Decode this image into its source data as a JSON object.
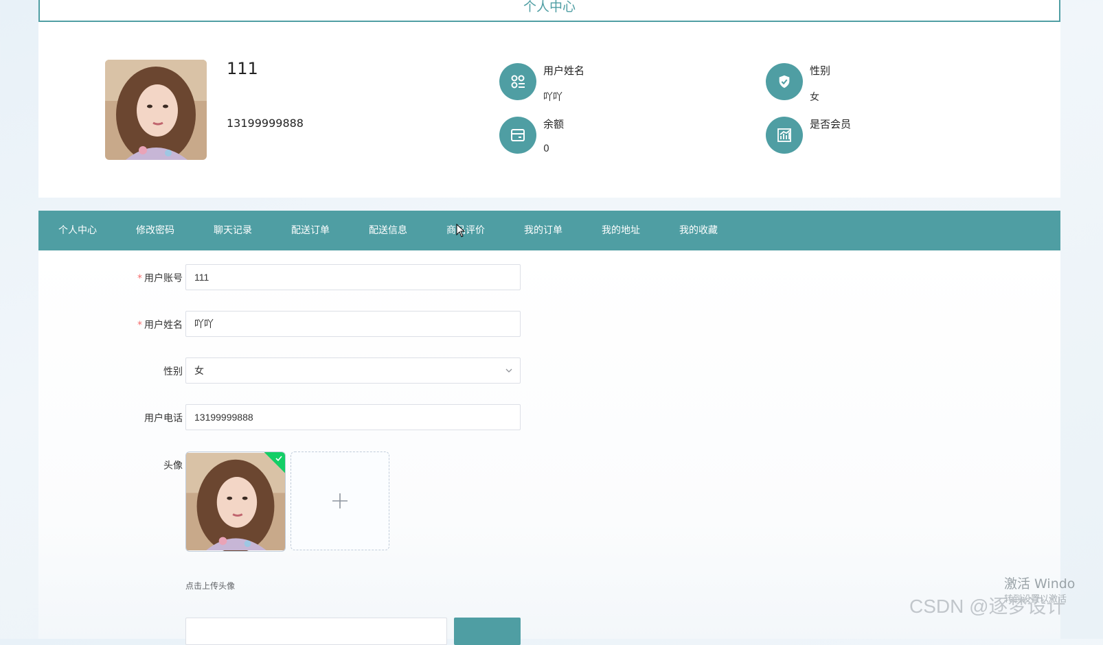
{
  "page": {
    "title": "个人中心"
  },
  "profile": {
    "account": "111",
    "phone": "13199999888",
    "fields": [
      {
        "icon": "grid-icon",
        "label": "用户姓名",
        "value": "吖吖"
      },
      {
        "icon": "shield-check-icon",
        "label": "性别",
        "value": "女"
      },
      {
        "icon": "wallet-icon",
        "label": "余额",
        "value": "0"
      },
      {
        "icon": "chart-icon",
        "label": "是否会员",
        "value": ""
      }
    ]
  },
  "tabs": [
    {
      "label": "个人中心"
    },
    {
      "label": "修改密码"
    },
    {
      "label": "聊天记录"
    },
    {
      "label": "配送订单"
    },
    {
      "label": "配送信息"
    },
    {
      "label": "商品评价"
    },
    {
      "label": "我的订单"
    },
    {
      "label": "我的地址"
    },
    {
      "label": "我的收藏"
    }
  ],
  "form": {
    "account_label": "用户账号",
    "account_value": "111",
    "name_label": "用户姓名",
    "name_value": "吖吖",
    "gender_label": "性别",
    "gender_value": "女",
    "phone_label": "用户电话",
    "phone_value": "13199999888",
    "avatar_label": "头像",
    "upload_tip": "点击上传头像"
  },
  "watermarks": {
    "windows_line1": "激活 Windo",
    "windows_line2": "转到设置以激活",
    "csdn": "CSDN @逐梦设计"
  },
  "colors": {
    "accent": "#4f9ea3",
    "required": "#f56c6c",
    "success": "#13ce66"
  }
}
